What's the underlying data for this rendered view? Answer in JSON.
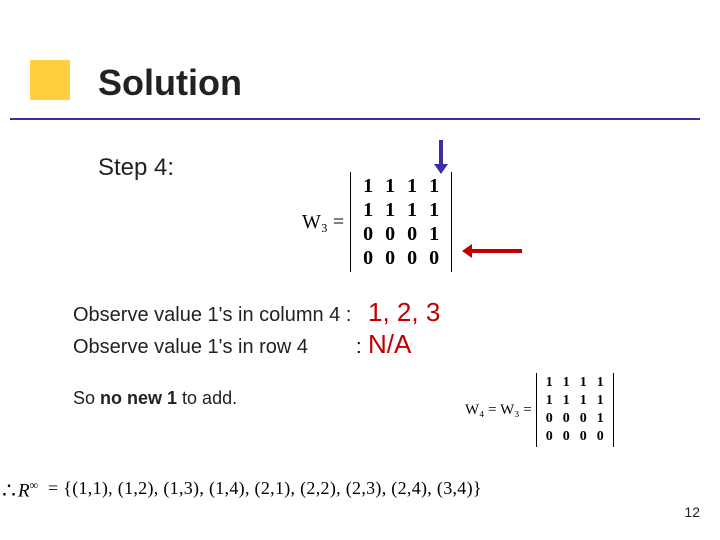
{
  "title": "Solution",
  "step": "Step 4:",
  "w3": {
    "label": "W₃ =",
    "rows": [
      [
        "1",
        "1",
        "1",
        "1"
      ],
      [
        "1",
        "1",
        "1",
        "1"
      ],
      [
        "0",
        "0",
        "0",
        "1"
      ],
      [
        "0",
        "0",
        "0",
        "0"
      ]
    ]
  },
  "obs1_prefix": "Observe value 1's in column 4 :",
  "obs1_value": "1, 2, 3",
  "obs2_prefix": "Observe value 1's in row 4",
  "obs2_colon": ":",
  "obs2_value": "N/A",
  "summary_pre": "So ",
  "summary_bold": "no new 1",
  "summary_post": " to add.",
  "w4": {
    "label": "W₄ = W₃ =",
    "rows": [
      [
        "1",
        "1",
        "1",
        "1"
      ],
      [
        "1",
        "1",
        "1",
        "1"
      ],
      [
        "0",
        "0",
        "0",
        "1"
      ],
      [
        "0",
        "0",
        "0",
        "0"
      ]
    ]
  },
  "therefore_symbol": "∴",
  "r_symbol": "R",
  "r_sup": "∞",
  "set_text": "= {(1,1), (1,2), (1,3), (1,4), (2,1), (2,2), (2,3), (2,4), (3,4)}",
  "page_number": "12"
}
